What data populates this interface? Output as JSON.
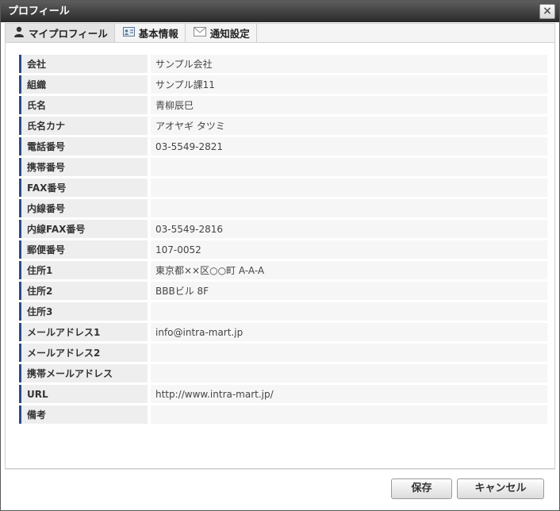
{
  "window": {
    "title": "プロフィール",
    "close_symbol": "×"
  },
  "tabs": [
    {
      "label": "マイプロフィール",
      "icon": "user-icon"
    },
    {
      "label": "基本情報",
      "icon": "id-card-icon"
    },
    {
      "label": "通知設定",
      "icon": "envelope-icon"
    }
  ],
  "fields": [
    {
      "label": "会社",
      "value": "サンプル会社"
    },
    {
      "label": "組織",
      "value": "サンプル課11"
    },
    {
      "label": "氏名",
      "value": "青柳辰巳"
    },
    {
      "label": "氏名カナ",
      "value": "アオヤギ タツミ"
    },
    {
      "label": "電話番号",
      "value": "03-5549-2821"
    },
    {
      "label": "携帯番号",
      "value": ""
    },
    {
      "label": "FAX番号",
      "value": ""
    },
    {
      "label": "内線番号",
      "value": ""
    },
    {
      "label": "内線FAX番号",
      "value": "03-5549-2816"
    },
    {
      "label": "郵便番号",
      "value": "107-0052"
    },
    {
      "label": "住所1",
      "value": "東京都××区○○町 A-A-A"
    },
    {
      "label": "住所2",
      "value": "BBBビル 8F"
    },
    {
      "label": "住所3",
      "value": ""
    },
    {
      "label": "メールアドレス1",
      "value": "info@intra-mart.jp"
    },
    {
      "label": "メールアドレス2",
      "value": ""
    },
    {
      "label": "携帯メールアドレス",
      "value": ""
    },
    {
      "label": "URL",
      "value": "http://www.intra-mart.jp/"
    },
    {
      "label": "備考",
      "value": ""
    }
  ],
  "buttons": {
    "save": "保存",
    "cancel": "キャンセル"
  },
  "colors": {
    "title_bg": "#3a3a3a",
    "label_accent": "#2b4a8a"
  }
}
